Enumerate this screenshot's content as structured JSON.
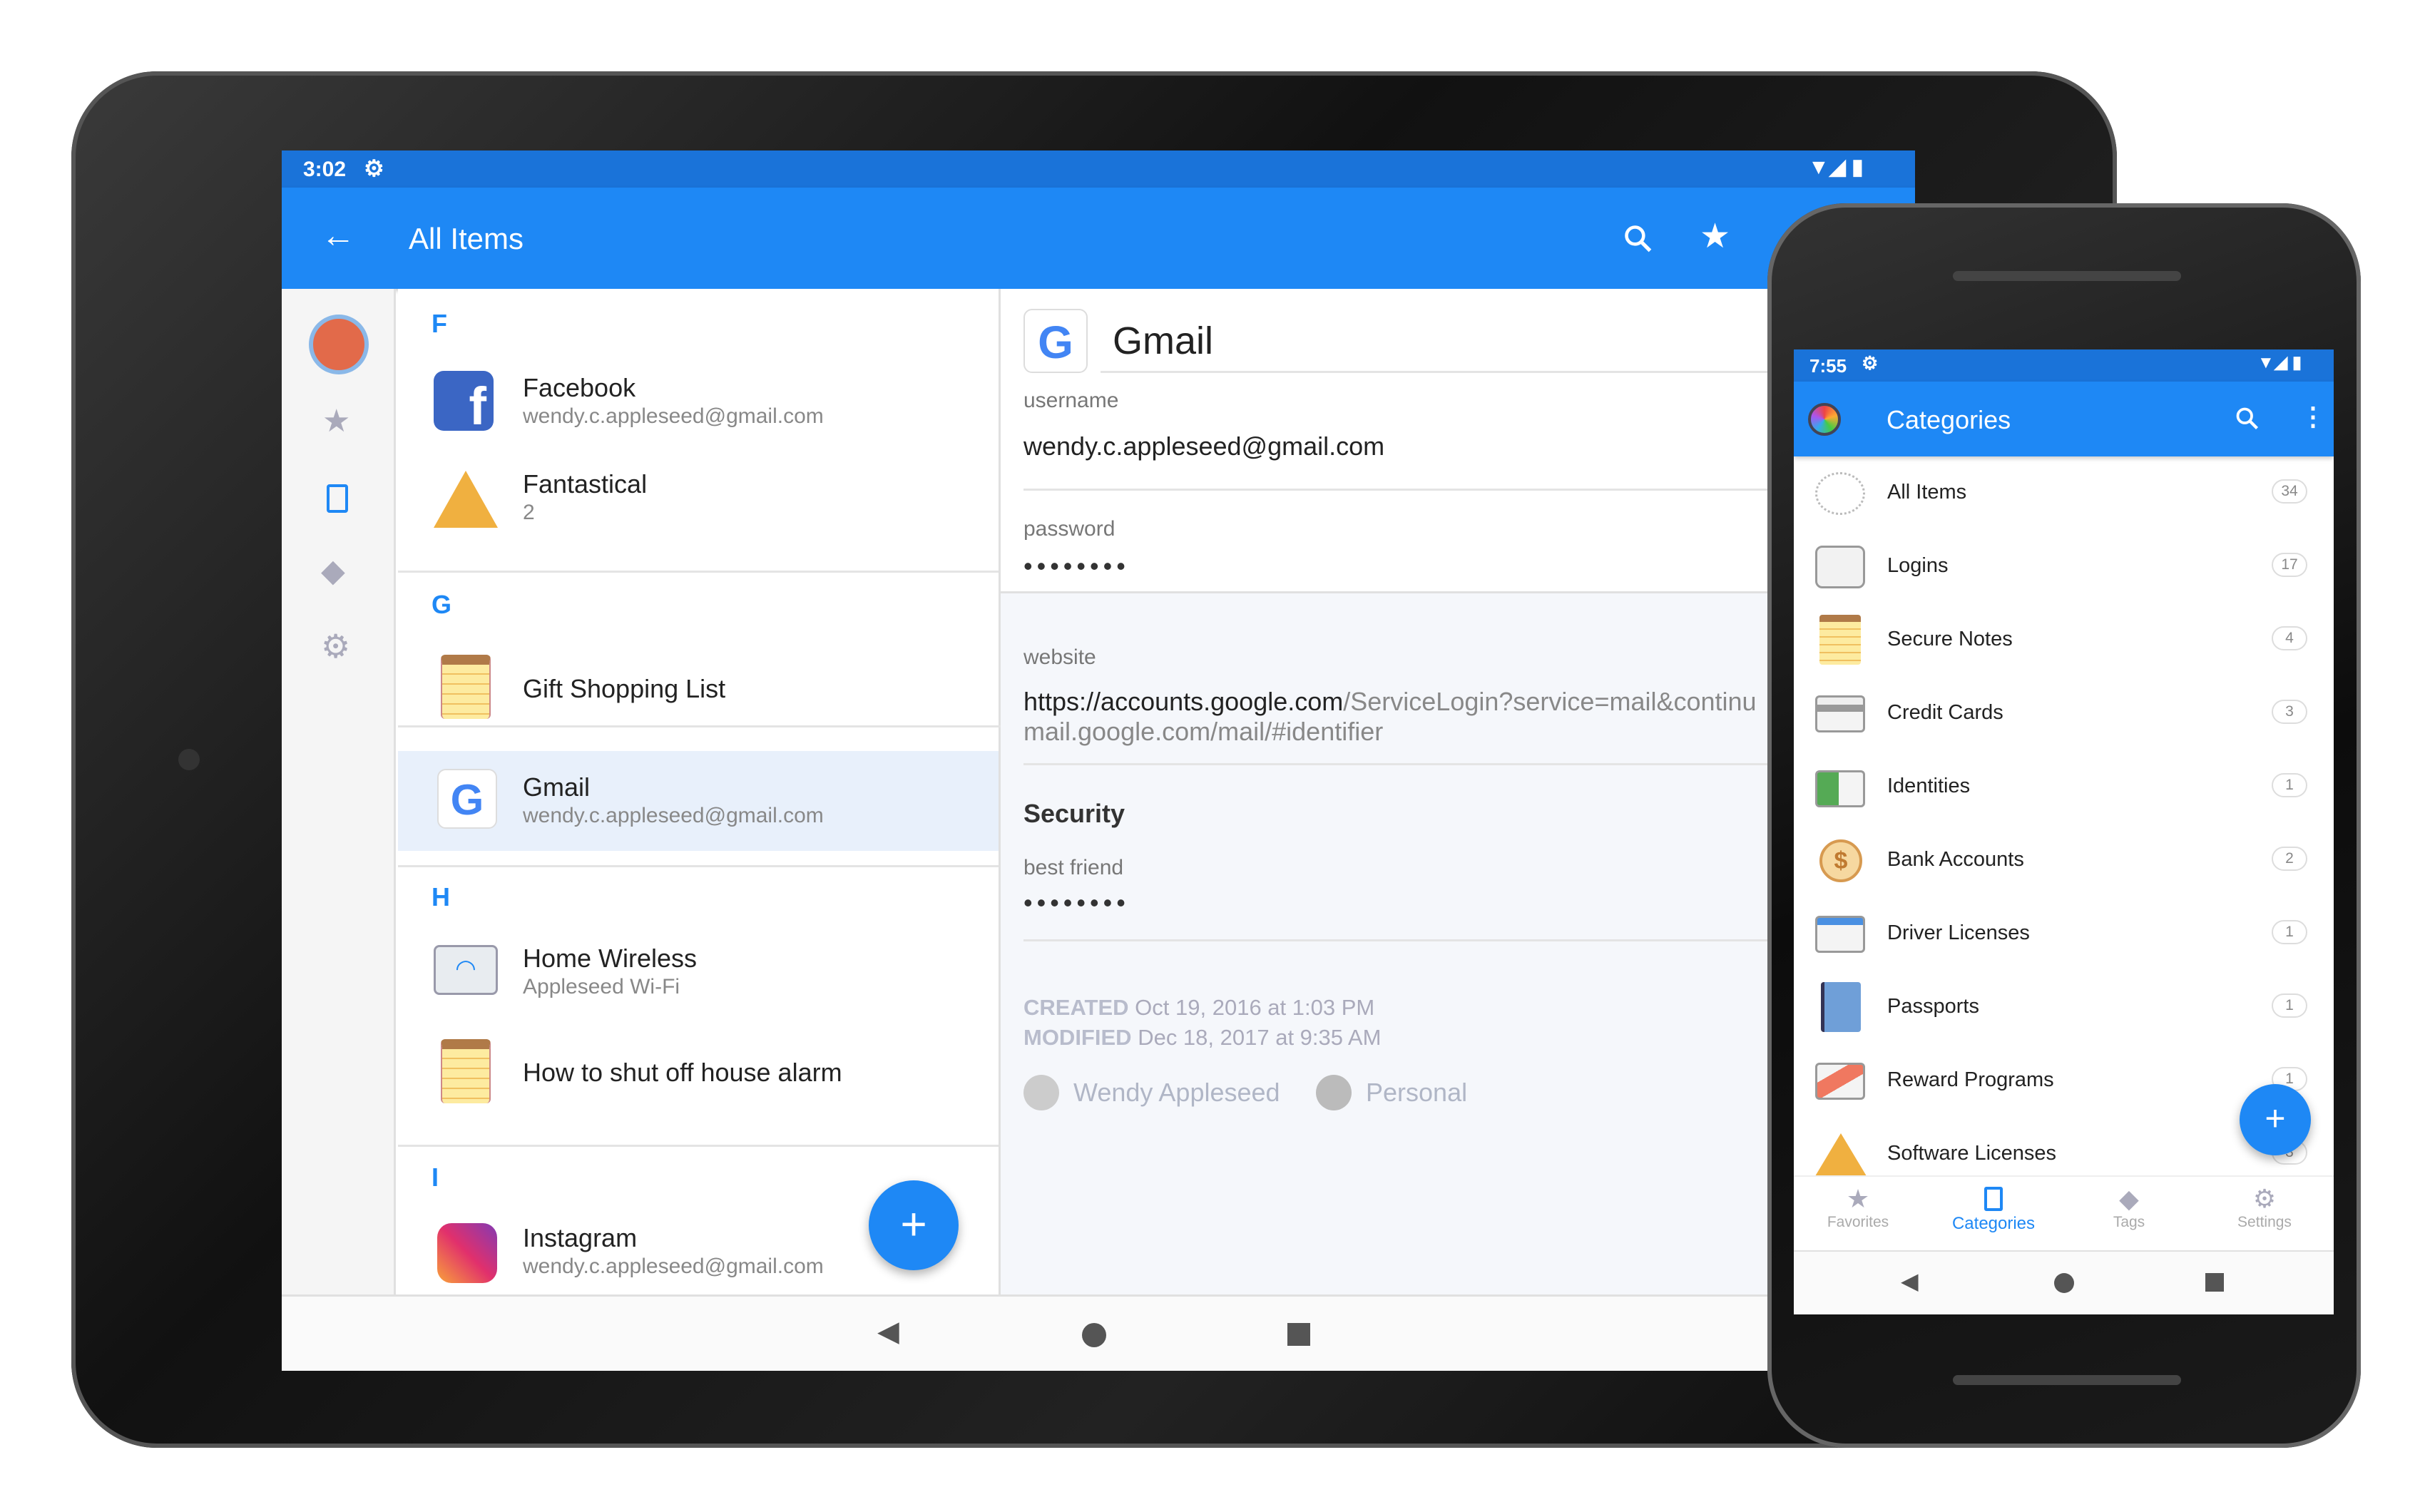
{
  "tablet": {
    "status": {
      "time": "3:02"
    },
    "appbar": {
      "title": "All Items",
      "back_icon": "arrow-left-icon",
      "search_icon": "search-icon",
      "favorite_icon": "star-icon"
    },
    "rail": [
      "vault-icon",
      "star-icon",
      "categories-icon",
      "tag-icon",
      "gear-icon"
    ],
    "list": {
      "sections": [
        {
          "letter": "F",
          "items": [
            {
              "title": "Facebook",
              "subtitle": "wendy.c.appleseed@gmail.com",
              "icon": "facebook-icon"
            },
            {
              "title": "Fantastical",
              "subtitle": "2",
              "icon": "software-license-icon"
            }
          ]
        },
        {
          "letter": "G",
          "items": [
            {
              "title": "Gift Shopping List",
              "subtitle": "",
              "icon": "secure-note-icon"
            },
            {
              "title": "Gmail",
              "subtitle": "wendy.c.appleseed@gmail.com",
              "icon": "google-icon",
              "selected": true
            }
          ]
        },
        {
          "letter": "H",
          "items": [
            {
              "title": "Home Wireless",
              "subtitle": "Appleseed Wi-Fi",
              "icon": "wireless-router-icon"
            },
            {
              "title": "How to shut off house alarm",
              "subtitle": "",
              "icon": "secure-note-icon"
            }
          ]
        },
        {
          "letter": "I",
          "items": [
            {
              "title": "Instagram",
              "subtitle": "wendy.c.appleseed@gmail.com",
              "icon": "instagram-icon"
            }
          ]
        }
      ],
      "fab": "+"
    },
    "detail": {
      "title": "Gmail",
      "username_label": "username",
      "username": "wendy.c.appleseed@gmail.com",
      "password_label": "password",
      "password": "••••••••",
      "website_label": "website",
      "website_host": "https://accounts.google.com",
      "website_path": "/ServiceLogin?service=mail&continu",
      "website_line2": "mail.google.com/mail/#identifier",
      "section_title": "Security",
      "best_friend_label": "best friend",
      "best_friend": "••••••••",
      "created_label": "CREATED",
      "created": "Oct 19, 2016 at 1:03 PM",
      "modified_label": "MODIFIED",
      "modified": "Dec 18, 2017 at 9:35 AM",
      "owner": "Wendy Appleseed",
      "vault": "Personal"
    }
  },
  "phone": {
    "status": {
      "time": "7:55"
    },
    "appbar": {
      "title": "Categories"
    },
    "categories": [
      {
        "label": "All Items",
        "count": "34",
        "icon": "all-items-icon"
      },
      {
        "label": "Logins",
        "count": "17",
        "icon": "login-keyhole-icon"
      },
      {
        "label": "Secure Notes",
        "count": "4",
        "icon": "secure-note-icon"
      },
      {
        "label": "Credit Cards",
        "count": "3",
        "icon": "credit-card-icon"
      },
      {
        "label": "Identities",
        "count": "1",
        "icon": "identity-icon"
      },
      {
        "label": "Bank Accounts",
        "count": "2",
        "icon": "bank-coin-icon"
      },
      {
        "label": "Driver Licenses",
        "count": "1",
        "icon": "driver-license-icon"
      },
      {
        "label": "Passports",
        "count": "1",
        "icon": "passport-icon"
      },
      {
        "label": "Reward Programs",
        "count": "1",
        "icon": "reward-icon"
      },
      {
        "label": "Software Licenses",
        "count": "3",
        "icon": "software-license-icon"
      }
    ],
    "fab": "+",
    "bottom_nav": [
      {
        "label": "Favorites",
        "icon": "star-icon"
      },
      {
        "label": "Categories",
        "icon": "categories-icon",
        "active": true
      },
      {
        "label": "Tags",
        "icon": "tag-icon"
      },
      {
        "label": "Settings",
        "icon": "gear-icon"
      }
    ]
  },
  "colors": {
    "primary": "#1e88f5",
    "status_bar": "#1a73d9",
    "selected_row": "#e8f0fb",
    "detail_bg": "#f5f7fb"
  }
}
